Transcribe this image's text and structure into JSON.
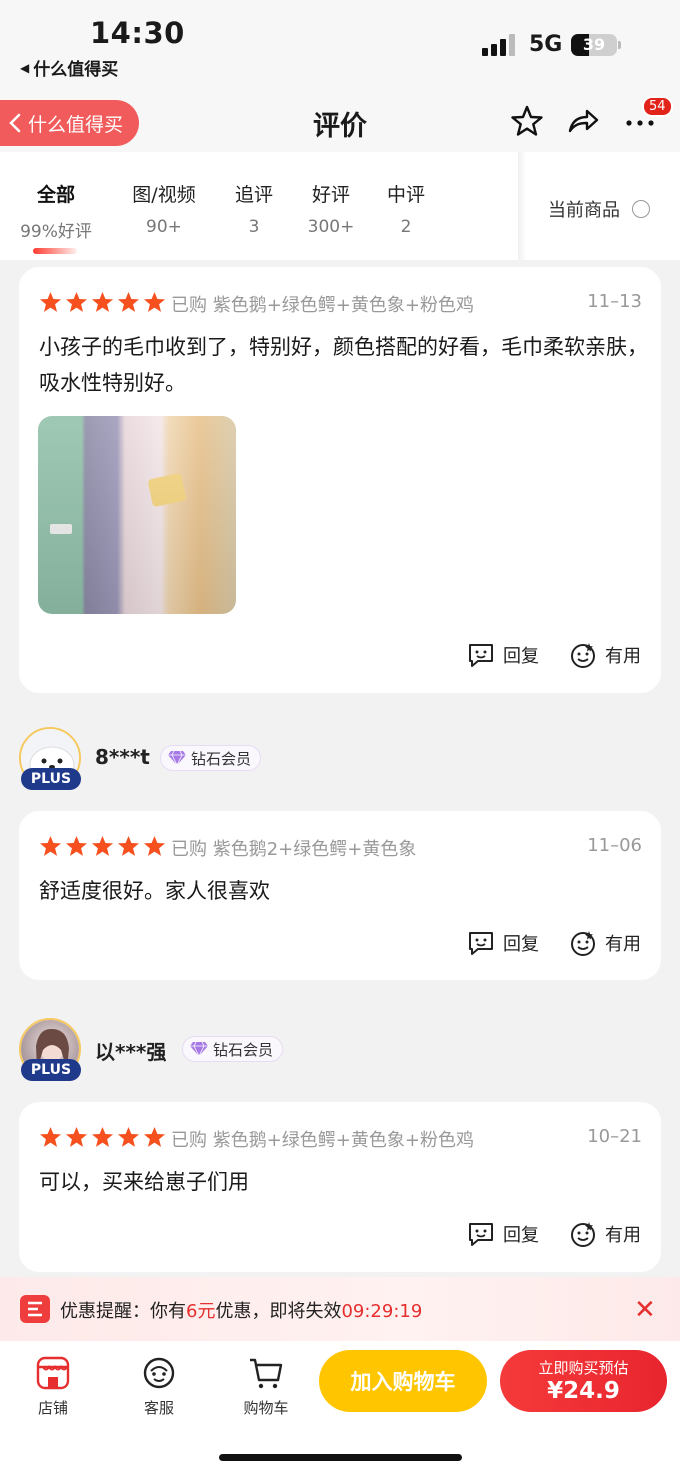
{
  "status_bar": {
    "time": "14:30",
    "back_app": "什么值得买",
    "network": "5G",
    "battery": "39"
  },
  "nav": {
    "back_label": "什么值得买",
    "title": "评价",
    "badge": "54"
  },
  "tabs": [
    {
      "label": "全部",
      "sub": "99%好评"
    },
    {
      "label": "图/视频",
      "sub": "90+"
    },
    {
      "label": "追评",
      "sub": "3"
    },
    {
      "label": "好评",
      "sub": "300+"
    },
    {
      "label": "中评",
      "sub": "2"
    }
  ],
  "current_item_label": "当前商品",
  "reviews": [
    {
      "rating": 5,
      "purchased": "已购 紫色鹅+绿色鳄+黄色象+粉色鸡",
      "date": "11–13",
      "content": "小孩子的毛巾收到了，特别好，颜色搭配的好看，毛巾柔软亲肤，吸水性特别好。",
      "reply_label": "回复",
      "useful_label": "有用"
    },
    {
      "user": {
        "name": "8***t",
        "level": "钻石会员",
        "plus": "PLUS"
      },
      "rating": 5,
      "purchased": "已购 紫色鹅2+绿色鳄+黄色象",
      "date": "11–06",
      "content": "舒适度很好。家人很喜欢",
      "reply_label": "回复",
      "useful_label": "有用"
    },
    {
      "user": {
        "name": "以***强",
        "level": "钻石会员",
        "plus": "PLUS"
      },
      "rating": 5,
      "purchased": "已购 紫色鹅+绿色鳄+黄色象+粉色鸡",
      "date": "10–21",
      "content": "可以，买来给崽子们用",
      "reply_label": "回复",
      "useful_label": "有用"
    }
  ],
  "promo": {
    "prefix": "优惠提醒：你有",
    "amount": "6元",
    "middle": "优惠，即将失效",
    "countdown": "09:29:19"
  },
  "bottom_bar": {
    "store": "店铺",
    "service": "客服",
    "cart": "购物车",
    "add_to_cart": "加入购物车",
    "buy_now": "立即购买预估",
    "price": "¥24.9"
  },
  "colors": {
    "accent": "#e62e2e",
    "star": "#f5501e",
    "cart_button": "#ffc600",
    "plus_badge": "#1f3a8a"
  }
}
